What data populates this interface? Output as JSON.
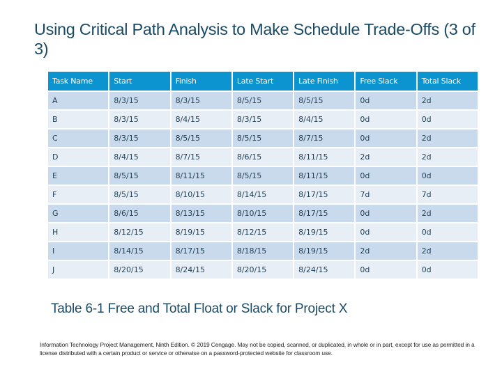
{
  "slide": {
    "title": "Using Critical Path Analysis to Make Schedule Trade-Offs (3 of 3)",
    "caption": "Table 6-1 Free and Total Float or Slack for Project X",
    "footer": "Information Technology Project Management, Ninth Edition. © 2019 Cengage. May not be copied, scanned, or duplicated, in whole or in part, except for use as permitted in a license distributed with a certain product or service or otherwise on a password-protected website for classroom use."
  },
  "table": {
    "headers": [
      "Task Name",
      "Start",
      "Finish",
      "Late Start",
      "Late Finish",
      "Free Slack",
      "Total Slack"
    ],
    "rows": [
      [
        "A",
        "8/3/15",
        "8/3/15",
        "8/5/15",
        "8/5/15",
        "0d",
        "2d"
      ],
      [
        "B",
        "8/3/15",
        "8/4/15",
        "8/3/15",
        "8/4/15",
        "0d",
        "0d"
      ],
      [
        "C",
        "8/3/15",
        "8/5/15",
        "8/5/15",
        "8/7/15",
        "0d",
        "2d"
      ],
      [
        "D",
        "8/4/15",
        "8/7/15",
        "8/6/15",
        "8/11/15",
        "2d",
        "2d"
      ],
      [
        "E",
        "8/5/15",
        "8/11/15",
        "8/5/15",
        "8/11/15",
        "0d",
        "0d"
      ],
      [
        "F",
        "8/5/15",
        "8/10/15",
        "8/14/15",
        "8/17/15",
        "7d",
        "7d"
      ],
      [
        "G",
        "8/6/15",
        "8/13/15",
        "8/10/15",
        "8/17/15",
        "0d",
        "2d"
      ],
      [
        "H",
        "8/12/15",
        "8/19/15",
        "8/12/15",
        "8/19/15",
        "0d",
        "0d"
      ],
      [
        "I",
        "8/14/15",
        "8/17/15",
        "8/18/15",
        "8/19/15",
        "2d",
        "2d"
      ],
      [
        "J",
        "8/20/15",
        "8/24/15",
        "8/20/15",
        "8/24/15",
        "0d",
        "0d"
      ]
    ]
  },
  "colors": {
    "header_bg": "#0b94cf",
    "row_odd_bg": "#cadaed",
    "row_even_bg": "#e7eef6",
    "title_text": "#1b4a64"
  }
}
